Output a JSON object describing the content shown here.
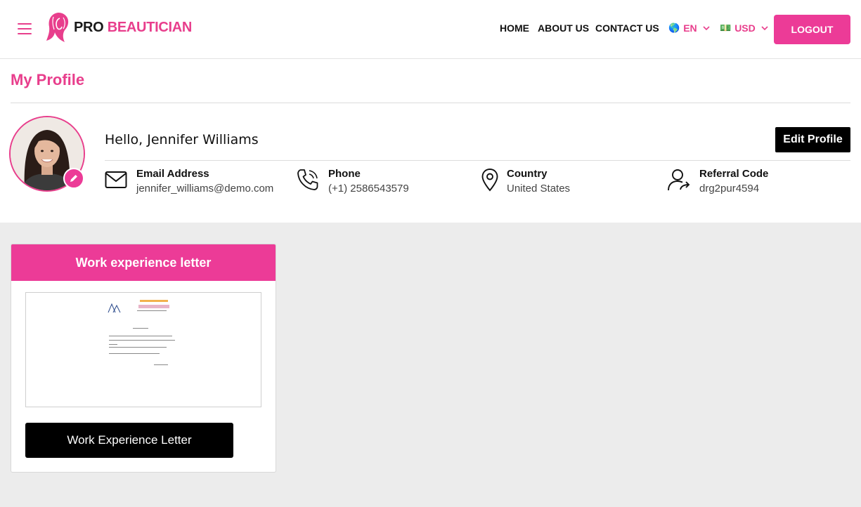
{
  "brand": {
    "pro": "PRO",
    "name": "BEAUTICIAN",
    "accent": "#e83e8c"
  },
  "nav": {
    "home": "HOME",
    "about": "ABOUT US",
    "contact": "CONTACT US"
  },
  "language": {
    "flag": "🌎",
    "value": "EN"
  },
  "currency": {
    "flag": "💵",
    "value": "USD"
  },
  "logout_label": "LOGOUT",
  "profile": {
    "title": "My Profile",
    "greeting": "Hello, Jennifer Williams",
    "edit_label": "Edit Profile",
    "email": {
      "label": "Email Address",
      "value": "jennifer_williams@demo.com"
    },
    "phone": {
      "label": "Phone",
      "value": "(+1) 2586543579"
    },
    "country": {
      "label": "Country",
      "value": "United States"
    },
    "referral": {
      "label": "Referral Code",
      "value": "drg2pur4594"
    }
  },
  "document_card": {
    "title": "Work experience letter",
    "button_label": "Work Experience Letter"
  },
  "icons": {
    "menu": "hamburger-icon",
    "logo": "woman-hair-logo-icon",
    "email": "envelope-icon",
    "phone": "phone-icon",
    "country": "map-pin-icon",
    "referral": "user-share-icon",
    "avatar_edit": "pencil-icon"
  }
}
